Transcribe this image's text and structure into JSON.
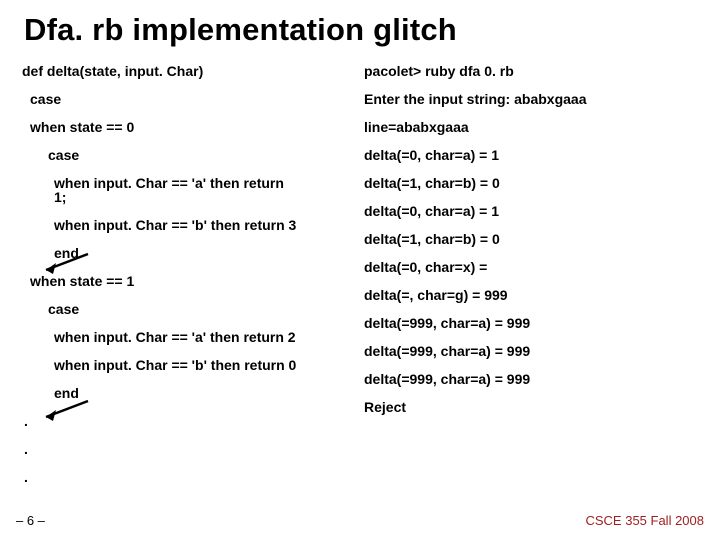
{
  "title": "Dfa. rb implementation glitch",
  "left": {
    "l0": "def delta(state, input. Char)",
    "l1": "case",
    "l2": "when state == 0",
    "l3": "case",
    "l4": "when input. Char == 'a' then return 1;",
    "l5": "when input. Char == 'b' then return 3",
    "l6": "end",
    "l7": "when state == 1",
    "l8": "case",
    "l9": "when input. Char == 'a' then return 2",
    "l10": "when input. Char == 'b' then return 0",
    "l11": "end",
    "d1": ".",
    "d2": ".",
    "d3": "."
  },
  "right": {
    "r0": "pacolet> ruby dfa 0. rb",
    "r1": "Enter the input string: ababxgaaa",
    "r2": "line=ababxgaaa",
    "r3": "delta(=0, char=a) = 1",
    "r4": "delta(=1, char=b) = 0",
    "r5": "delta(=0, char=a) = 1",
    "r6": "delta(=1, char=b) = 0",
    "r7": "delta(=0, char=x) =",
    "r8": "delta(=, char=g) = 999",
    "r9": "delta(=999, char=a) = 999",
    "r10": "delta(=999, char=a) = 999",
    "r11": "delta(=999, char=a) = 999",
    "r12": "Reject"
  },
  "footer": {
    "pageNum": "– 6 –",
    "course": "CSCE 355 Fall 2008"
  }
}
